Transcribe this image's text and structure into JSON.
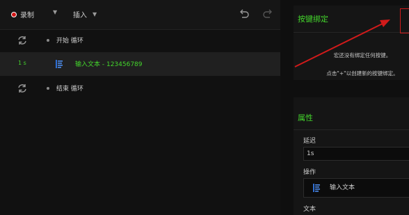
{
  "toolbar": {
    "record_label": "录制",
    "insert_label": "插入",
    "caret": "▼"
  },
  "macro": {
    "rows": [
      {
        "text": "开始 循环"
      },
      {
        "delay": "1 s",
        "text": "输入文本 - 123456789"
      },
      {
        "text": "结束 循环"
      }
    ]
  },
  "keybind": {
    "title": "按键绑定",
    "line1": "宏还没有绑定任何按键。",
    "line2": "点击\"+\"以创建新的按键绑定。"
  },
  "properties": {
    "title": "属性",
    "delay_label": "延迟",
    "delay_value": "1s",
    "action_label": "操作",
    "action_value": "输入文本",
    "text_label": "文本"
  },
  "colors": {
    "accent": "#44d62c",
    "record": "#d01515",
    "annotation": "#d11a1a"
  }
}
